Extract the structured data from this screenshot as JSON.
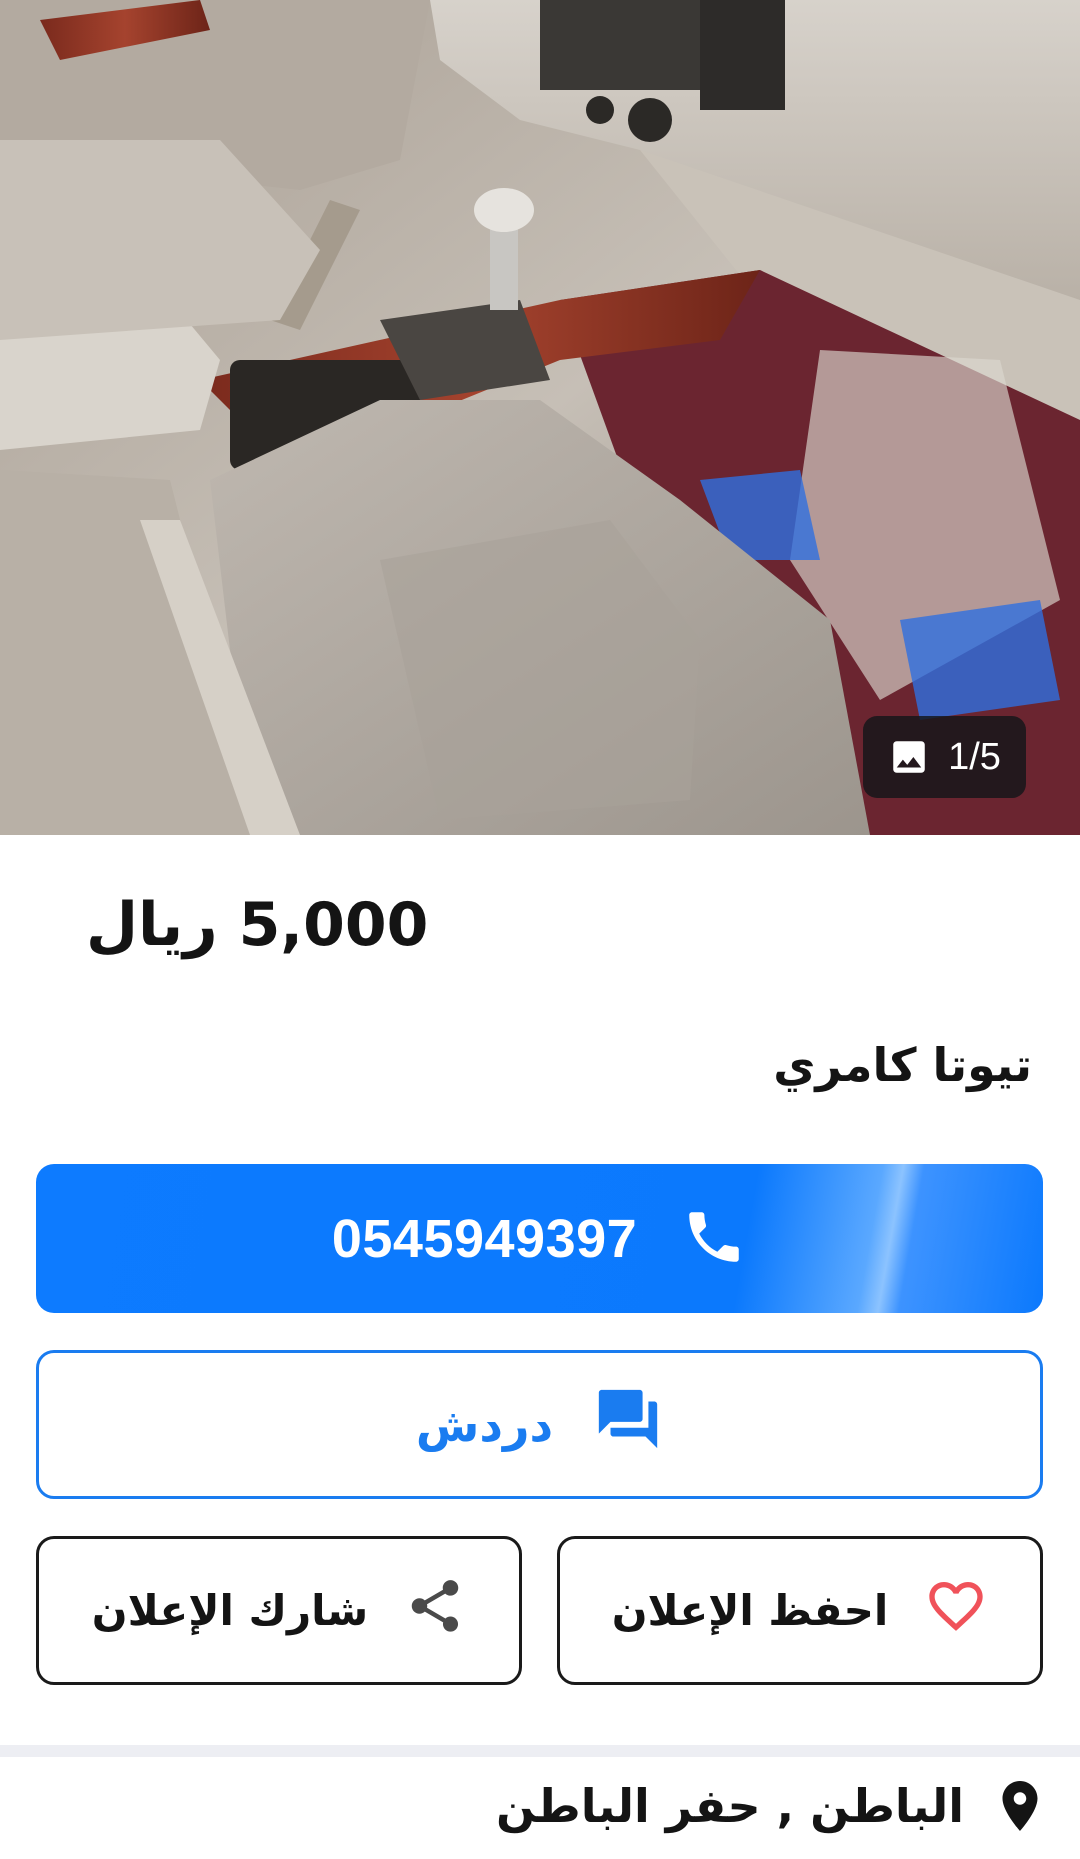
{
  "gallery": {
    "photo_counter": "1/5",
    "photo_icon": "image-icon"
  },
  "listing": {
    "price": "5,000 ريال",
    "title": "تيوتا كامري"
  },
  "actions": {
    "call_label": "0545949397",
    "call_icon": "phone-icon",
    "chat_label": "دردش",
    "chat_icon": "chat-bubbles-icon",
    "save_label": "احفظ الإعلان",
    "save_icon": "heart-icon",
    "share_label": "شارك الإعلان",
    "share_icon": "share-icon"
  },
  "location": {
    "text": "الباطن , حفر الباطن",
    "icon": "location-pin-icon"
  },
  "colors": {
    "primary_blue": "#0b79fd",
    "outline_blue": "#1a7cf0",
    "heart_red": "#f0525a",
    "text_dark": "#141414"
  }
}
